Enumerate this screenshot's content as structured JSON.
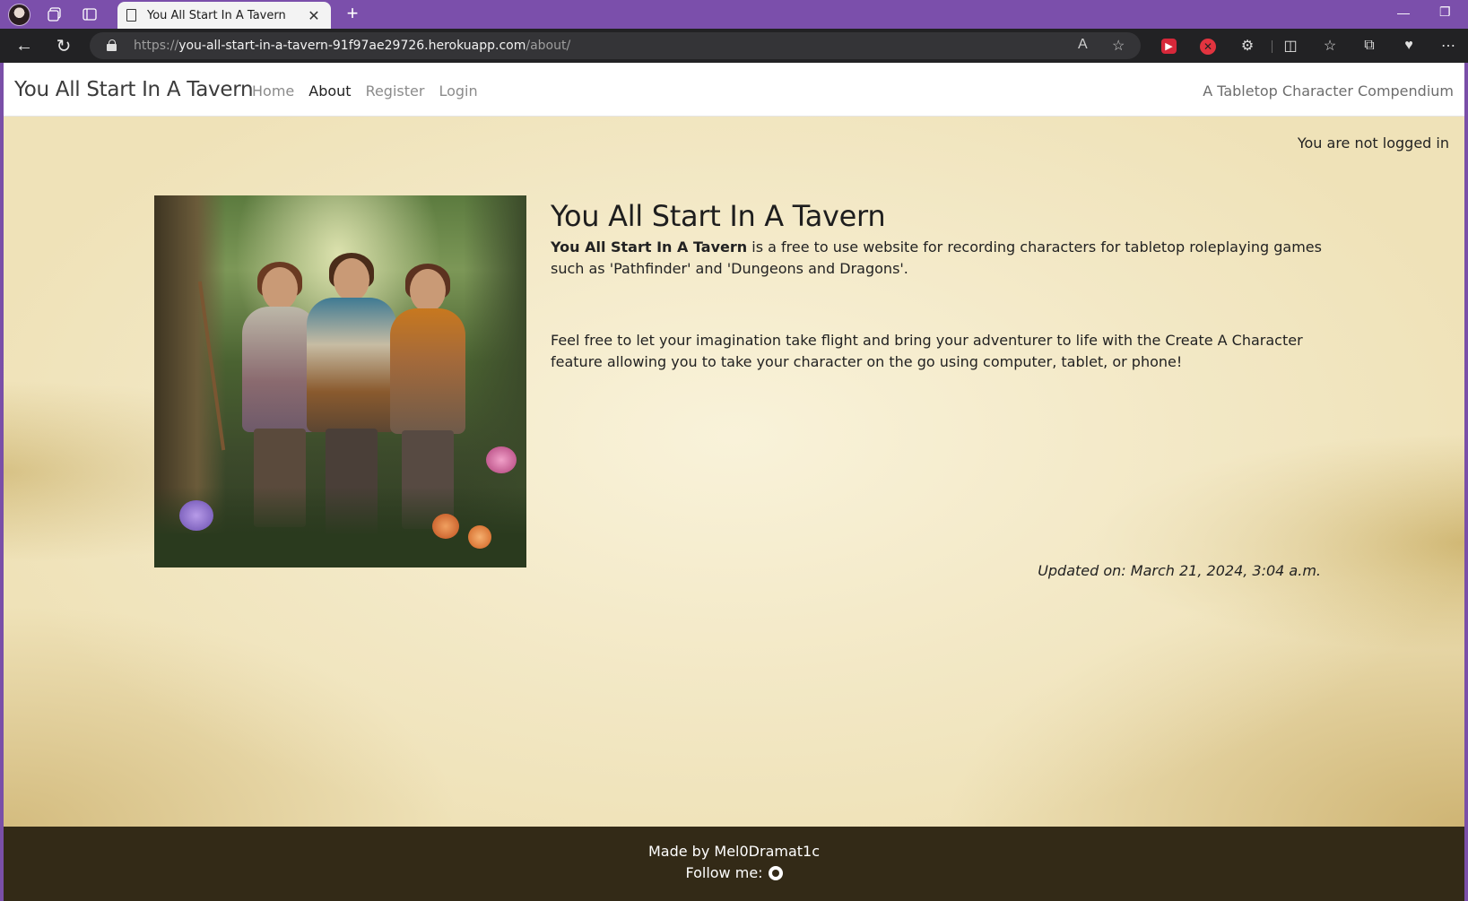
{
  "browser": {
    "tab_title": "You All Start In A Tavern",
    "url_scheme": "https://",
    "url_host": "you-all-start-in-a-tavern-91f97ae29726.herokuapp.com",
    "url_path": "/about/"
  },
  "nav": {
    "brand": "You All Start In A Tavern",
    "links": [
      "Home",
      "About",
      "Register",
      "Login"
    ],
    "active": "About",
    "tagline": "A Tabletop Character Compendium"
  },
  "status": {
    "login": "You are not logged in"
  },
  "about": {
    "title": "You All Start In A Tavern",
    "p1_bold": "You All Start In A Tavern",
    "p1_rest": " is a free to use website for recording characters for tabletop roleplaying games such as 'Pathfinder' and 'Dungeons and Dragons'.",
    "p2": "Feel free to let your imagination take flight and bring your adventurer to life with the Create A Character feature allowing you to take your character on the go using computer, tablet, or phone!",
    "updated": "Updated on: March 21, 2024, 3:04 a.m."
  },
  "footer": {
    "made_by": "Made by Mel0Dramat1c",
    "follow": "Follow me:"
  },
  "colors": {
    "titlebar": "#7b4fab",
    "addressbar": "#222224",
    "parchment": "#efe2b8",
    "footer": "#332a17"
  },
  "icons": [
    "profile-avatar-icon",
    "workspaces-icon",
    "tab-actions-icon",
    "document-icon",
    "close-icon",
    "new-tab-icon",
    "back-icon",
    "refresh-icon",
    "lock-icon",
    "read-aloud-icon",
    "favorite-star-icon",
    "extension-icon",
    "split-screen-icon",
    "favorites-icon",
    "collections-icon",
    "browser-essentials-icon",
    "more-icon",
    "github-icon"
  ]
}
